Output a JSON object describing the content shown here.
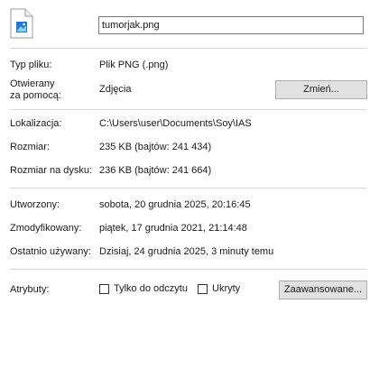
{
  "file": {
    "name": "tumorjak.png",
    "icon": "png-image-file-icon"
  },
  "labels": {
    "type": "Typ pliku:",
    "opens_with_line1": "Otwierany",
    "opens_with_line2": "za pomocą:",
    "location": "Lokalizacja:",
    "size": "Rozmiar:",
    "size_on_disk": "Rozmiar na dysku:",
    "created": "Utworzony:",
    "modified": "Zmodyfikowany:",
    "accessed": "Ostatnio używany:",
    "attributes": "Atrybuty:"
  },
  "values": {
    "type": "Plik PNG (.png)",
    "opens_with": "Zdjęcia",
    "location": "C:\\Users\\user\\Documents\\Soy\\IAS",
    "size": "235 KB (bajtów: 241 434)",
    "size_on_disk": "236 KB (bajtów: 241 664)",
    "created": "sobota, 20 grudnia 2025, 20:16:45",
    "modified": "piątek, 17 grudnia 2021, 21:14:48",
    "accessed": "Dzisiaj, 24 grudnia 2025, 3 minuty temu"
  },
  "buttons": {
    "change": "Zmień...",
    "advanced": "Zaawansowane..."
  },
  "attributes": {
    "read_only_label": "Tylko do odczytu",
    "read_only_checked": false,
    "hidden_label": "Ukryty",
    "hidden_checked": false
  }
}
